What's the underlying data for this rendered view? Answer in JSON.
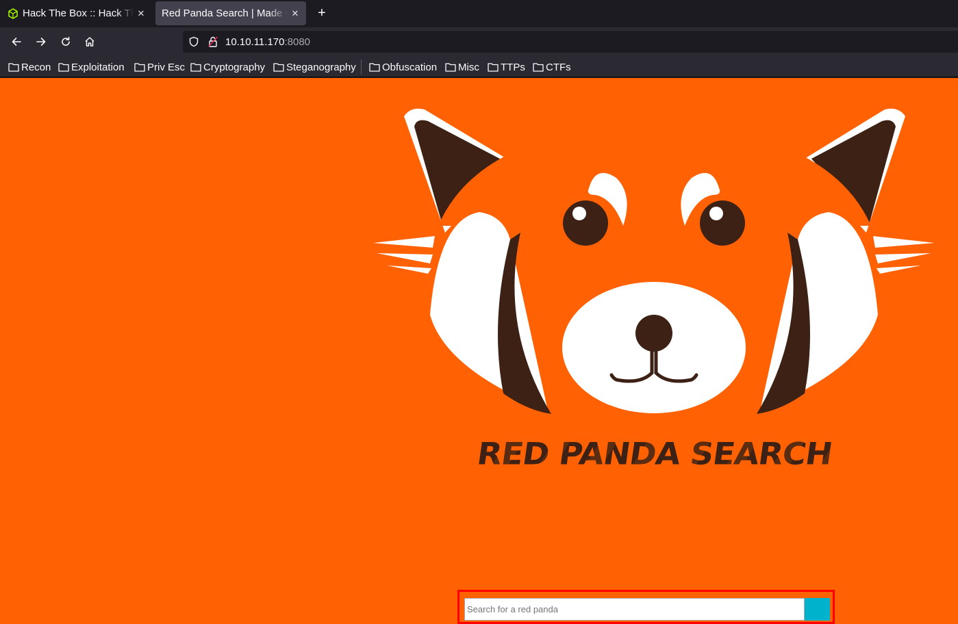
{
  "browser": {
    "tabs": [
      {
        "title": "Hack The Box :: Hack The Box",
        "active": false,
        "favicon": "htb-cube-icon"
      },
      {
        "title": "Red Panda Search | Made with Spring Boot",
        "active": true,
        "favicon": "none"
      }
    ],
    "new_tab_label": "+",
    "url": {
      "host": "10.10.11.170",
      "port": ":8080"
    },
    "bookmarks": [
      "Recon",
      "Exploitation",
      "Priv Esc",
      "Cryptography",
      "Steganography",
      "Obfuscation",
      "Misc",
      "TTPs",
      "CTFs"
    ]
  },
  "page": {
    "background_color": "#ff6103",
    "brand_text": "RED PANDA SEARCH",
    "search": {
      "placeholder": "Search for a red panda",
      "value": "",
      "button_color": "#00b2cc"
    }
  }
}
